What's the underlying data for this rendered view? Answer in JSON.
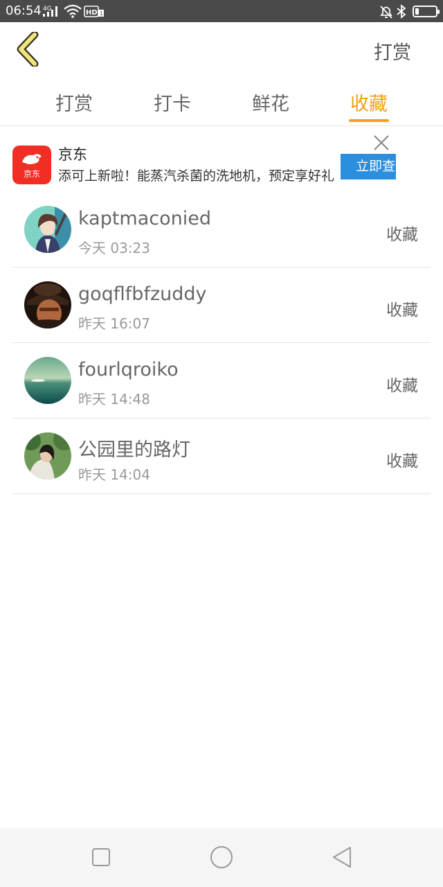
{
  "status_bar": {
    "time": "06:54",
    "network_label": "4G",
    "hd_label": "HD",
    "hd_sub": "1",
    "icons": [
      "signal-icon",
      "wifi-icon",
      "hd-icon",
      "alarm-off-icon",
      "bluetooth-icon",
      "battery-icon"
    ],
    "battery_level": 0.18
  },
  "header": {
    "back_icon": "chevron-left-icon",
    "action_label": "打赏"
  },
  "tabs": [
    {
      "label": "打赏",
      "active": false
    },
    {
      "label": "打卡",
      "active": false
    },
    {
      "label": "鲜花",
      "active": false
    },
    {
      "label": "收藏",
      "active": true
    }
  ],
  "ad": {
    "logo_label": "京东",
    "title": "京东",
    "description": "添可上新啦！能蒸汽杀菌的洗地机，预定享好礼",
    "cta_label": "立即查看",
    "close_icon": "close-icon"
  },
  "list": [
    {
      "name": "kaptmaconied",
      "time": "今天 03:23",
      "status": "收藏"
    },
    {
      "name": "goqflfbfzuddy",
      "time": "昨天 16:07",
      "status": "收藏"
    },
    {
      "name": "fourlqroiko",
      "time": "昨天 14:48",
      "status": "收藏"
    },
    {
      "name": "公园里的路灯",
      "time": "昨天 14:04",
      "status": "收藏"
    }
  ],
  "nav": {
    "icons": [
      "recent-apps-icon",
      "home-icon",
      "back-triangle-icon"
    ]
  },
  "colors": {
    "accent": "#f5a015",
    "statusbar_bg": "#4a4a4a",
    "ad_button": "#2b8fde",
    "jd_red": "#f12e24",
    "back_chevron_fill": "#f3e57a"
  }
}
